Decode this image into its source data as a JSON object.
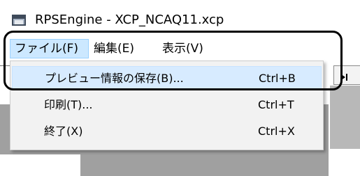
{
  "window": {
    "title": "RPSEngine - XCP_NCAQ11.xcp",
    "icon": "app-window-icon"
  },
  "menubar": {
    "items": [
      {
        "label": "ファイル(F)",
        "active": true
      },
      {
        "label": "編集(E)",
        "active": false
      },
      {
        "label": "表示(V)",
        "active": false
      }
    ]
  },
  "file_menu": {
    "items": [
      {
        "label": "プレビュー情報の保存(B)...",
        "shortcut": "Ctrl+B",
        "highlighted": true
      },
      {
        "label": "印刷(T)...",
        "shortcut": "Ctrl+T",
        "highlighted": false
      },
      {
        "label": "終了(X)",
        "shortcut": "Ctrl+X",
        "highlighted": false
      }
    ]
  },
  "toolbar": {
    "icon": "play-step-icon"
  },
  "colors": {
    "menu_active_bg": "#cce8ff",
    "menu_active_border": "#99d1ff",
    "dropdown_bg": "#f2f2f2",
    "dropdown_highlight": "#d7ebff",
    "workspace_gray": "#a0a0a0",
    "annotation": "#000000"
  }
}
